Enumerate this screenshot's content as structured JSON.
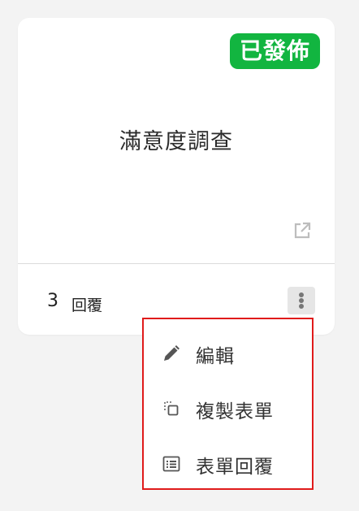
{
  "card": {
    "status_badge": "已發佈",
    "status_color": "#12b540",
    "title": "滿意度調查",
    "open_icon": "external-link-icon",
    "response_count": "3",
    "response_label": "回覆",
    "more_icon": "vertical-ellipsis-icon"
  },
  "menu": {
    "highlight_color": "#e01b1b",
    "items": [
      {
        "label": "編輯",
        "icon": "pencil-icon"
      },
      {
        "label": "複製表單",
        "icon": "copy-icon"
      },
      {
        "label": "表單回覆",
        "icon": "list-icon"
      }
    ]
  }
}
